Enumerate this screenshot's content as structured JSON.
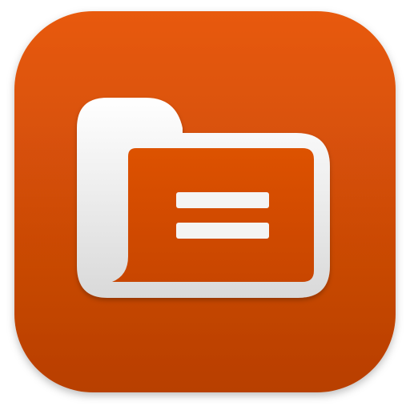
{
  "icon": {
    "name": "folder-document-app-icon",
    "glyph": "folder-with-lines",
    "colors": {
      "background_top": "#e85a08",
      "background_bottom": "#b83f05",
      "folder_light": "#ffffff",
      "folder_shade": "#d9d9d9",
      "inner_panel_top": "#dd5206",
      "inner_panel_bottom": "#c84505",
      "line_color": "#f4f4f4"
    }
  }
}
